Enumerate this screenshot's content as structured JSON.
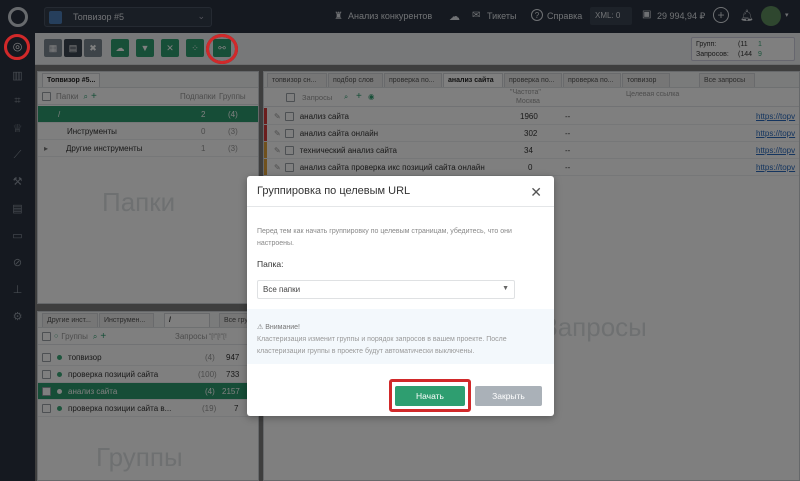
{
  "topbar": {
    "project": "Топвизор #5",
    "competitors": "Анализ конкурентов",
    "tickets": "Тикеты",
    "help": "Справка",
    "xml": "XML: 0",
    "balance": "29 994,94 ₽"
  },
  "stats": {
    "groups_label": "Групп:",
    "groups_value": "(11",
    "groups_extra": "1",
    "queries_label": "Запросов:",
    "queries_value": "(144",
    "queries_extra": "9"
  },
  "folders": {
    "tab": "Топвизор #5...",
    "head_label": "Папки",
    "col_queries": "Подпапки",
    "col_groups": "Группы",
    "rows": [
      {
        "name": "/",
        "q": "2",
        "g": "(4)"
      },
      {
        "name": "Инструменты",
        "q": "0",
        "g": "(3)"
      },
      {
        "name": "Другие инструменты",
        "q": "1",
        "g": "(3)"
      }
    ],
    "watermark": "Папки"
  },
  "groups": {
    "tabs": [
      "Другие инст...",
      "Инструмен...",
      "/",
      "Все групп"
    ],
    "head_label": "Группы",
    "col_queries": "Запросы",
    "col_extra": "\"[!\"[!\"[!",
    "rows": [
      {
        "name": "топвизор",
        "c": "(4)",
        "v": "947"
      },
      {
        "name": "проверка позиций сайта",
        "c": "(100)",
        "v": "733"
      },
      {
        "name": "анализ сайта",
        "c": "(4)",
        "v": "2157"
      },
      {
        "name": "проверка позиции сайта в...",
        "c": "(19)",
        "v": "7"
      }
    ],
    "watermark": "Группы"
  },
  "queries": {
    "tabs": [
      "топвизор сн...",
      "подбор слов",
      "проверка по...",
      "анализ сайта",
      "проверка по...",
      "проверка по...",
      "топвизор",
      "Все запросы"
    ],
    "head_label": "Запросы",
    "col_freq": "\"Частота\"",
    "col_region": "Москва",
    "col_url": "Целевая ссылка",
    "rows": [
      {
        "q": "анализ сайта",
        "f": "1960",
        "u": "--",
        "l": "https://topv"
      },
      {
        "q": "анализ сайта онлайн",
        "f": "302",
        "u": "--",
        "l": "https://topv"
      },
      {
        "q": "технический анализ сайта",
        "f": "34",
        "u": "--",
        "l": "https://topv"
      },
      {
        "q": "анализ сайта проверка икс позиций сайта онлайн",
        "f": "0",
        "u": "--",
        "l": "https://topv"
      }
    ],
    "watermark": "Запросы"
  },
  "modal": {
    "title": "Группировка по целевым URL",
    "intro": "Перед тем как начать группировку по целевым страницам, убедитесь, что они настроены.",
    "folder_label": "Папка:",
    "folder_value": "Все папки",
    "warn_title": "Внимание!",
    "warn_text": "Кластеризация изменит группы и порядок запросов в вашем проекте. После кластеризации группы в проекте будут автоматически выключены.",
    "start": "Начать",
    "close": "Закрыть"
  },
  "colors": {
    "accent": "#2e9e70",
    "highlight": "#d1292a",
    "dark": "#2b3340"
  }
}
